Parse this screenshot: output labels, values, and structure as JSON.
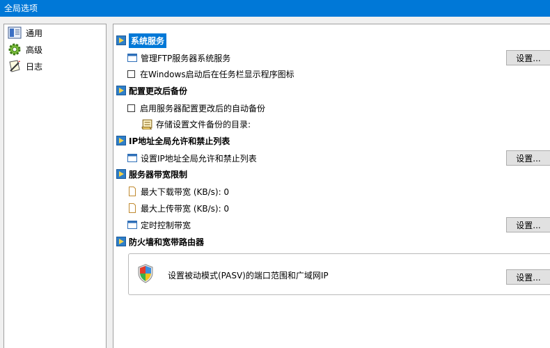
{
  "window": {
    "title": "全局选项"
  },
  "sidebar": {
    "items": [
      {
        "label": "通用",
        "icon": "general-icon"
      },
      {
        "label": "高级",
        "icon": "gear-icon"
      },
      {
        "label": "日志",
        "icon": "log-icon"
      }
    ]
  },
  "sections": {
    "system": {
      "title": "系统服务",
      "manage_service_label": "管理FTP服务器系统服务",
      "tray_icon_label": "在Windows启动后在任务栏显示程序图标",
      "settings_label": "设置..."
    },
    "backup": {
      "title": "配置更改后备份",
      "auto_backup_label": "启用服务器配置更改后的自动备份",
      "backup_dir_label": "存储设置文件备份的目录:"
    },
    "ip": {
      "title": "IP地址全局允许和禁止列表",
      "set_list_label": "设置IP地址全局允许和禁止列表",
      "settings_label": "设置..."
    },
    "bandwidth": {
      "title": "服务器带宽限制",
      "max_download_label": "最大下载带宽 (KB/s): 0",
      "max_upload_label": "最大上传带宽 (KB/s): 0",
      "scheduled_label": "定时控制带宽",
      "settings_label": "设置..."
    },
    "firewall": {
      "title": "防火墙和宽带路由器",
      "pasv_label": "设置被动模式(PASV)的端口范围和广域网IP",
      "settings_label": "设置..."
    }
  },
  "colors": {
    "accent": "#0078d7",
    "titlebar_text": "#ffffff"
  }
}
